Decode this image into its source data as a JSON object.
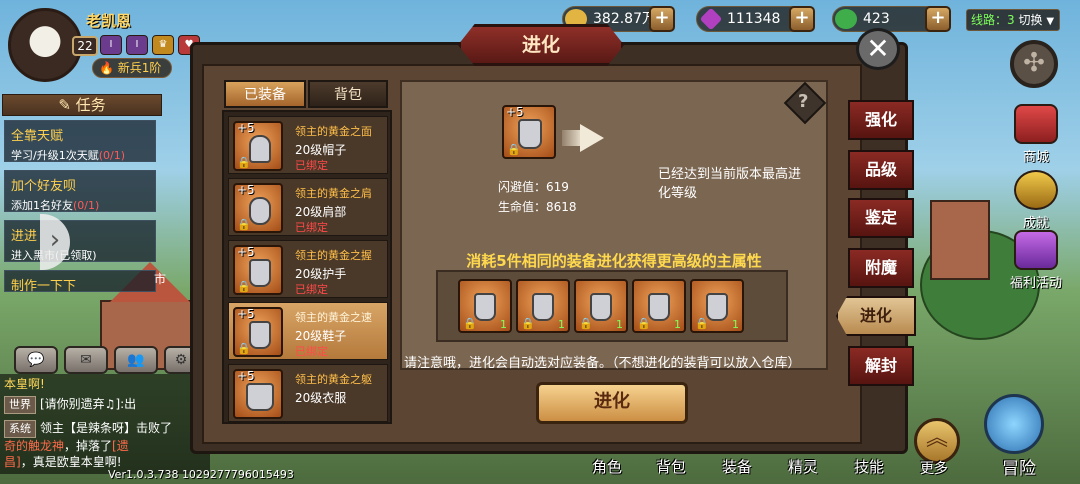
{
  "player": {
    "name": "老凯恩",
    "level": "22",
    "rank_title": "新兵1阶"
  },
  "resources": {
    "gold": "382.87万",
    "gems": "111348",
    "stamina": "423"
  },
  "server": {
    "line": "线路：3",
    "switch": "切换"
  },
  "tasks": {
    "header": "任务",
    "items": [
      {
        "title": "全靠天赋",
        "desc": "学习/升级1次天赋",
        "progress": "(0/1)"
      },
      {
        "title": "加个好友呗",
        "desc": "添加1名好友",
        "progress": "(0/1)"
      },
      {
        "title": "进进",
        "desc": "进入",
        "progress": "黑市(已领取)"
      },
      {
        "title": "制作一下下",
        "desc": "",
        "progress": ""
      }
    ],
    "side_label": "市"
  },
  "chat": {
    "lines": [
      {
        "text": "本皇啊!"
      },
      {
        "tag": "世界",
        "text": "[请你别遗弃♫]:出"
      },
      {
        "tag": "系统",
        "pre": "领主【是辣条呀】击败了",
        "highlight": ""
      },
      {
        "pre": "奇的触龙神",
        "mid": "，掉落了",
        "item": "[遗"
      },
      {
        "item": "昌]",
        "post": "，真是欧皇本皇啊!"
      }
    ]
  },
  "version": "Ver1.0.3.738 1029277796015493",
  "dialog": {
    "title": "进化",
    "tabs": [
      "已装备",
      "背包"
    ],
    "equipment": [
      {
        "plus": "+5",
        "name": "领主的黄金之面",
        "type": "20级帽子",
        "bound": "已绑定"
      },
      {
        "plus": "+5",
        "name": "领主的黄金之肩",
        "type": "20级肩部",
        "bound": "已绑定"
      },
      {
        "plus": "+5",
        "name": "领主的黄金之握",
        "type": "20级护手",
        "bound": "已绑定"
      },
      {
        "plus": "+5",
        "name": "领主的黄金之速",
        "type": "20级鞋子",
        "bound": "已绑定"
      },
      {
        "plus": "+5",
        "name": "领主的黄金之躯",
        "type": "20级衣服",
        "bound": ""
      }
    ],
    "selected": {
      "plus": "+5",
      "dodge_label": "闪避值：",
      "dodge": "619",
      "hp_label": "生命值：",
      "hp": "8618"
    },
    "max_message": "已经达到当前版本最高进化等级",
    "consume_title": "消耗5件相同的装备进化获得更高级的主属性",
    "materials": [
      "1",
      "1",
      "1",
      "1",
      "1"
    ],
    "notice": "请注意哦，进化会自动选对应装备。（不想进化的装背可以放入仓库）",
    "evolve_button": "进化",
    "side_tabs": [
      "强化",
      "品级",
      "鉴定",
      "附魔",
      "进化",
      "解封"
    ],
    "active_side_tab": "进化"
  },
  "right_menu": [
    "商城",
    "成就",
    "福利活动"
  ],
  "bottom_bar": [
    "角色",
    "背包",
    "装备",
    "精灵",
    "技能",
    "更多",
    "冒险"
  ],
  "colors": {
    "title_plate": "#8e2f28",
    "bound_red": "#ff4a4a",
    "item_name_orange": "#ffbf4a",
    "consume_yellow": "#ffd94d"
  }
}
